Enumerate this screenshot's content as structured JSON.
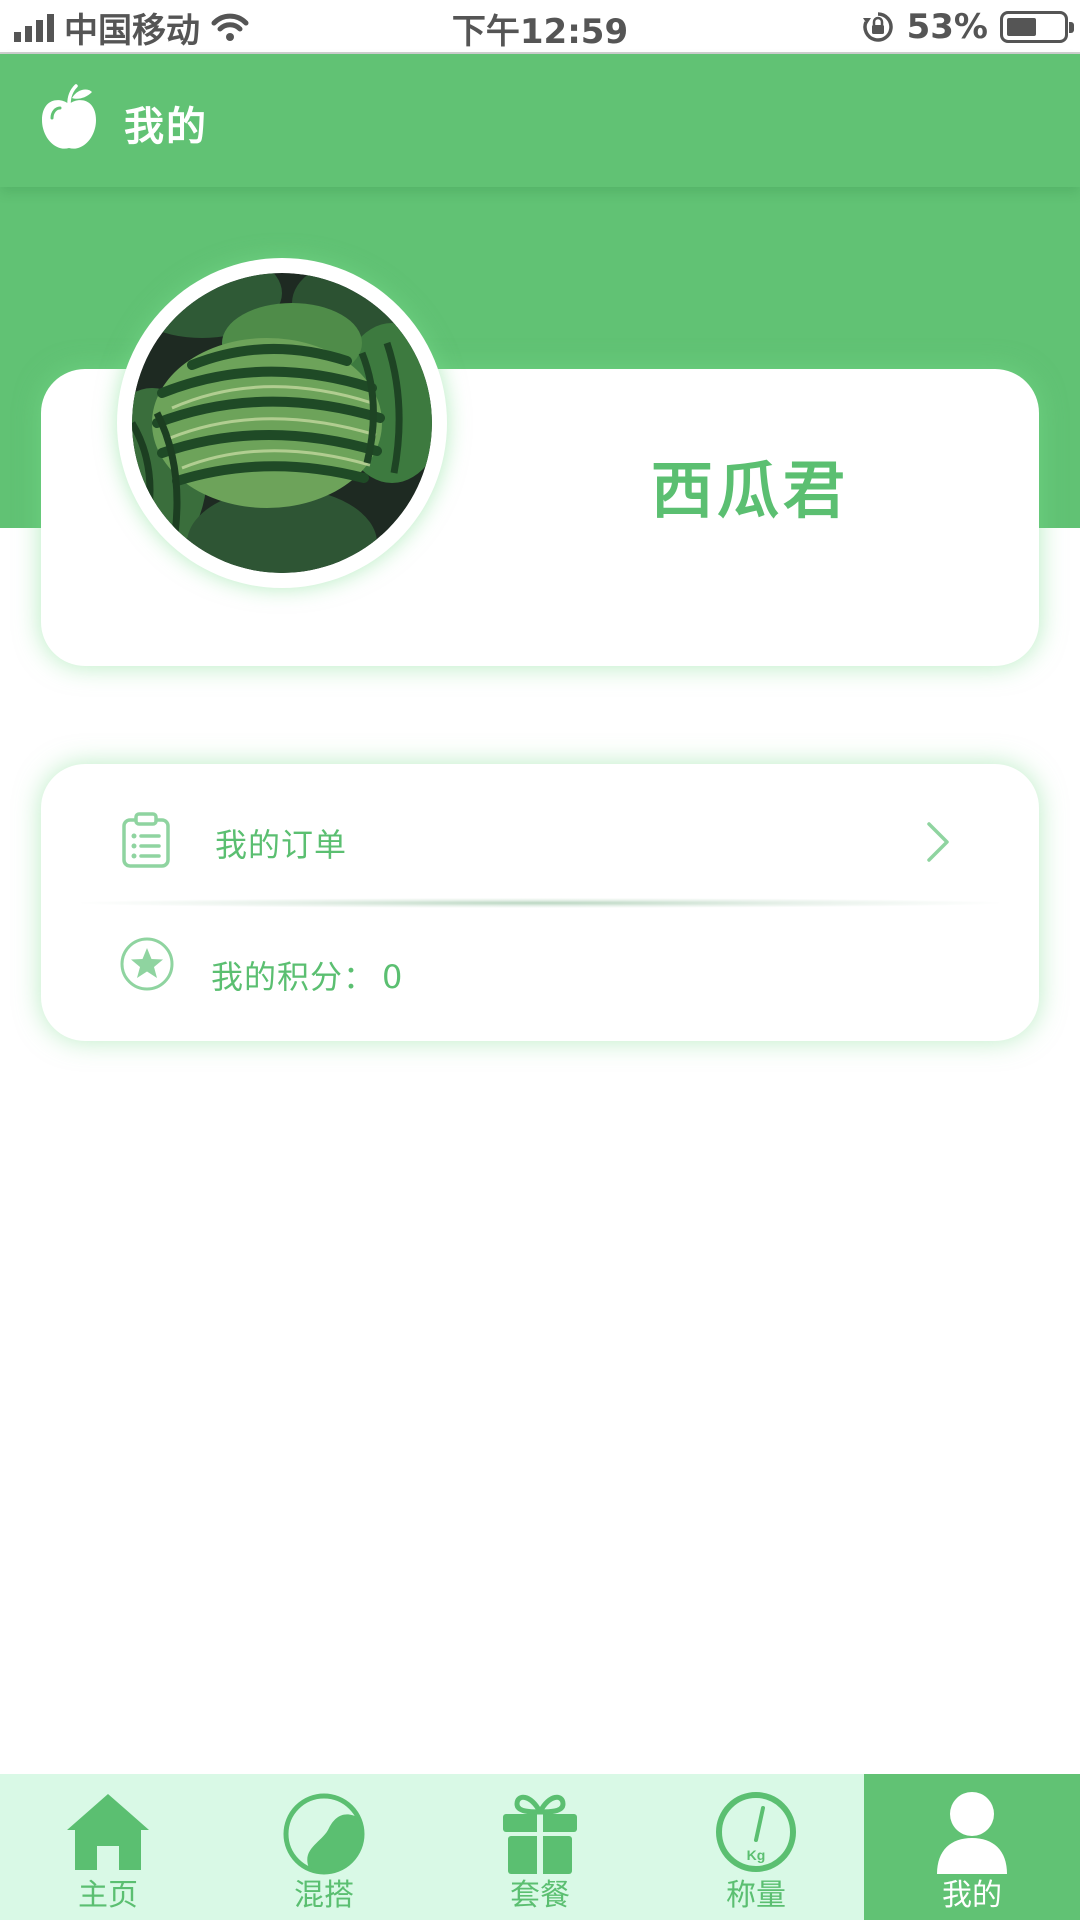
{
  "status_bar": {
    "carrier": "中国移动",
    "time": "下午12:59",
    "battery_percent": "53%",
    "battery_level": 0.53,
    "icons": [
      "signal-icon",
      "wifi-icon",
      "rotation-lock-icon",
      "battery-icon"
    ]
  },
  "header": {
    "title": "我的",
    "logo_icon": "apple-icon"
  },
  "profile": {
    "username": "西瓜君",
    "avatar": "watermelon-photo"
  },
  "menu": {
    "orders": {
      "label": "我的订单",
      "icon": "clipboard-icon"
    },
    "points": {
      "label": "我的积分：",
      "value": "0",
      "icon": "star-icon"
    }
  },
  "tabs": [
    {
      "label": "主页",
      "icon": "home-icon",
      "active": false
    },
    {
      "label": "混搭",
      "icon": "mix-icon",
      "active": false
    },
    {
      "label": "套餐",
      "icon": "gift-icon",
      "active": false
    },
    {
      "label": "称量",
      "icon": "scale-icon",
      "active": false
    },
    {
      "label": "我的",
      "icon": "user-icon",
      "active": true
    }
  ],
  "colors": {
    "primary_green": "#61c274",
    "text_green": "#5bbf71",
    "tab_bar_bg": "#d9f9e6"
  }
}
